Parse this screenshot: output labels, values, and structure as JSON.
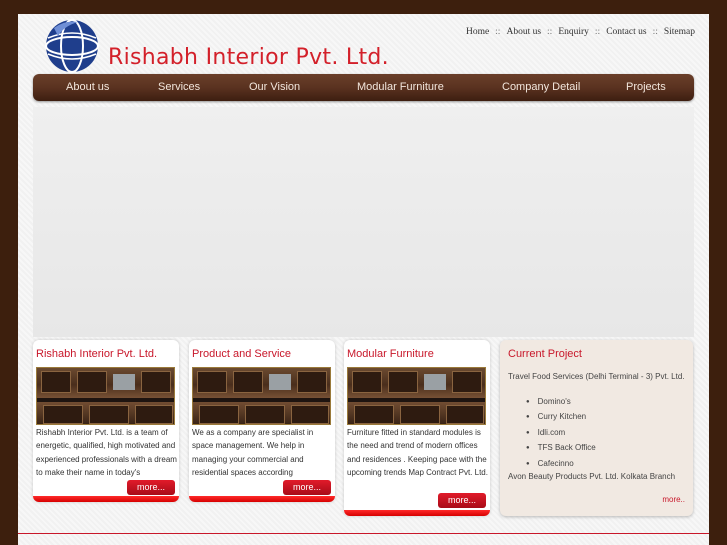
{
  "header": {
    "brand": "Rishabh Interior Pvt. Ltd.",
    "toplinks": [
      "Home",
      "About us",
      "Enquiry",
      "Contact us",
      "Sitemap"
    ],
    "separator": "::"
  },
  "nav": [
    "About us",
    "Services",
    "Our Vision",
    "Modular Furniture",
    "Company Detail",
    "Projects"
  ],
  "cards": [
    {
      "title": "Rishabh Interior Pvt. Ltd.",
      "text": "Rishabh Interior Pvt. Ltd. is a team of energetic, qualified, high motivated and experienced professionals with a dream to make their name in today's",
      "more": "more..."
    },
    {
      "title": "Product and Service",
      "text": "We as a company are specialist in space management.  We help in managing your commercial  and residential  spaces  according",
      "more": "more..."
    },
    {
      "title": "Modular Furniture",
      "text": "Furniture fitted in standard modules is the need and trend of modern offices and residences .   Keeping pace with the upcoming trends Map Contract Pvt. Ltd.",
      "more": "more..."
    }
  ],
  "current_project": {
    "title": "Current Project",
    "line1": "Travel Food Services (Delhi Terminal - 3) Pvt. Ltd.",
    "items": [
      "Domino's",
      "Curry Kitchen",
      "Idli.com",
      "TFS Back Office",
      "Cafecinno"
    ],
    "line2": "Avon Beauty Products Pvt. Ltd. Kolkata Branch",
    "more": "more.."
  },
  "colors": {
    "brand_red": "#d3202a",
    "nav_brown": "#5a3220",
    "background": "#3d1f0d"
  },
  "icons": {
    "logo": "globe-logo-icon"
  }
}
